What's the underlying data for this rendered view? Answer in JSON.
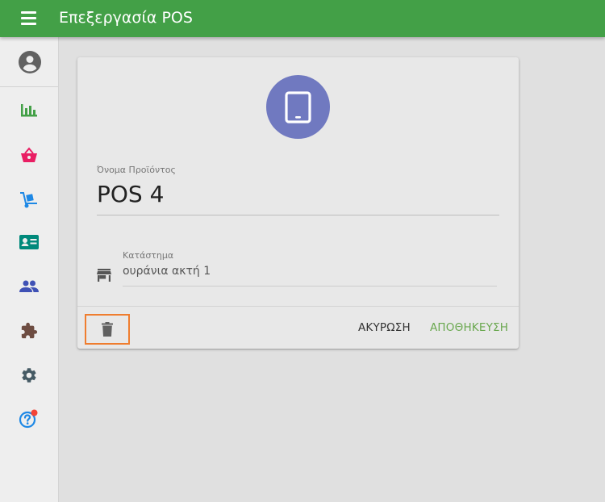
{
  "appbar": {
    "title": "Επεξεργασία POS",
    "color": "#43a047",
    "menu_icon": "menu-icon"
  },
  "sidebar": {
    "avatar_icon": "account-circle-icon",
    "items": [
      {
        "icon": "bar-chart-icon",
        "color": "#43a047"
      },
      {
        "icon": "shopping-basket-icon",
        "color": "#e91e63"
      },
      {
        "icon": "hand-truck-icon",
        "color": "#1e88e5"
      },
      {
        "icon": "contact-card-icon",
        "color": "#00897b"
      },
      {
        "icon": "people-icon",
        "color": "#3f51b5"
      },
      {
        "icon": "puzzle-icon",
        "color": "#6d4c41"
      },
      {
        "icon": "gear-icon",
        "color": "#455a64"
      },
      {
        "icon": "help-icon",
        "color": "#1e88e5",
        "badge_color": "#f44336"
      }
    ]
  },
  "card": {
    "device_icon": "tablet-icon",
    "device_color": "#7079c0",
    "name_label": "Όνομα Προϊόντος",
    "name_value": "POS 4",
    "store_label": "Κατάστημα",
    "store_value": "ουράνια ακτή 1",
    "store_icon": "store-icon",
    "delete_icon": "trash-icon",
    "cancel_label": "ΑΚΥΡΩΣΗ",
    "save_label": "ΑΠΟΘΗΚΕΥΣΗ",
    "save_color": "#6aa84f"
  }
}
